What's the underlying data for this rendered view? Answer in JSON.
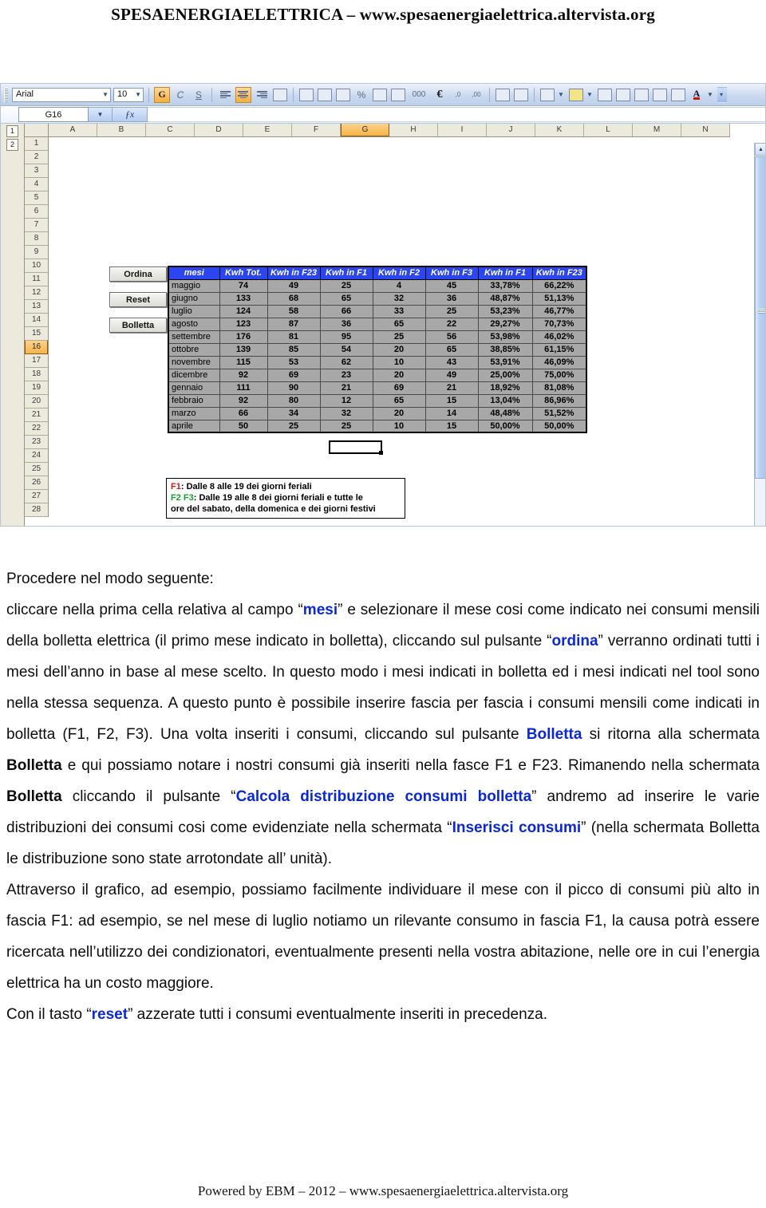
{
  "header": {
    "title": "SPESAENERGIAELETTRICA – www.spesaenergiaelettrica.altervista.org"
  },
  "footer": {
    "text": "Powered by EBM – 2012 – www.spesaenergiaelettrica.altervista.org"
  },
  "spreadsheet": {
    "toolbar": {
      "font_name": "Arial",
      "font_size": "10",
      "bold_label": "G",
      "italic_label": "C",
      "underline_label": "S",
      "percent_label": "%",
      "currency_label": "€",
      "thousands_label": "000",
      "inc_dec_label": ",0",
      "dec_dec_label": ",00",
      "font_color_label": "A"
    },
    "formula_bar": {
      "name_box": "G16",
      "fx_label": "fx",
      "formula_value": ""
    },
    "outline_buttons": [
      "1",
      "2"
    ],
    "column_headers": [
      "A",
      "B",
      "C",
      "D",
      "E",
      "F",
      "G",
      "H",
      "I",
      "J",
      "K",
      "L",
      "M",
      "N"
    ],
    "selected_column": "G",
    "row_headers": [
      "1",
      "2",
      "3",
      "4",
      "5",
      "6",
      "7",
      "8",
      "9",
      "10",
      "11",
      "12",
      "13",
      "14",
      "15",
      "16",
      "17",
      "18",
      "19",
      "20",
      "21",
      "22",
      "23",
      "24",
      "25",
      "26",
      "27",
      "28"
    ],
    "selected_row": "16"
  },
  "buttons": [
    {
      "label": "Ordina"
    },
    {
      "label": "Reset"
    },
    {
      "label": "Bolletta"
    }
  ],
  "table": {
    "headers": [
      "mesi",
      "Kwh Tot.",
      "Kwh in F23",
      "Kwh in F1",
      "Kwh in F2",
      "Kwh in F3",
      "Kwh in F1",
      "Kwh in F23"
    ],
    "rows": [
      [
        "maggio",
        "74",
        "49",
        "25",
        "4",
        "45",
        "33,78%",
        "66,22%"
      ],
      [
        "giugno",
        "133",
        "68",
        "65",
        "32",
        "36",
        "48,87%",
        "51,13%"
      ],
      [
        "luglio",
        "124",
        "58",
        "66",
        "33",
        "25",
        "53,23%",
        "46,77%"
      ],
      [
        "agosto",
        "123",
        "87",
        "36",
        "65",
        "22",
        "29,27%",
        "70,73%"
      ],
      [
        "settembre",
        "176",
        "81",
        "95",
        "25",
        "56",
        "53,98%",
        "46,02%"
      ],
      [
        "ottobre",
        "139",
        "85",
        "54",
        "20",
        "65",
        "38,85%",
        "61,15%"
      ],
      [
        "novembre",
        "115",
        "53",
        "62",
        "10",
        "43",
        "53,91%",
        "46,09%"
      ],
      [
        "dicembre",
        "92",
        "69",
        "23",
        "20",
        "49",
        "25,00%",
        "75,00%"
      ],
      [
        "gennaio",
        "111",
        "90",
        "21",
        "69",
        "21",
        "18,92%",
        "81,08%"
      ],
      [
        "febbraio",
        "92",
        "80",
        "12",
        "65",
        "15",
        "13,04%",
        "86,96%"
      ],
      [
        "marzo",
        "66",
        "34",
        "32",
        "20",
        "14",
        "48,48%",
        "51,52%"
      ],
      [
        "aprile",
        "50",
        "25",
        "25",
        "10",
        "15",
        "50,00%",
        "50,00%"
      ]
    ]
  },
  "legend": {
    "f1_tag": "F1",
    "f1_text": ": Dalle 8 alle 19 dei giorni feriali",
    "f2_tag": "F2",
    "f3_tag": "F3",
    "f23_text": ": Dalle 19 alle 8 dei giorni feriali e tutte le",
    "f23_text2": "ore del sabato, della domenica e dei giorni festivi"
  },
  "body": {
    "intro": "Procedere nel modo seguente:",
    "p1_a": "cliccare nella prima cella relativa al campo “",
    "p1_k1": "mesi",
    "p1_b": "” e selezionare il mese cosi come indicato nei consumi mensili della bolletta elettrica (il primo mese indicato in bolletta), cliccando sul pulsante “",
    "p1_k2": "ordina",
    "p1_c": "” verranno ordinati tutti i mesi dell’anno in base al mese scelto. In questo modo i mesi indicati in bolletta ed i mesi indicati nel tool sono nella stessa sequenza. A questo punto è possibile inserire fascia per fascia i consumi mensili come indicati in bolletta (F1, F2, F3). Una volta inseriti i consumi, cliccando sul pulsante ",
    "p1_k3": "Bolletta",
    "p1_d": " si ritorna alla schermata ",
    "p1_k4": "Bolletta",
    "p1_e": " e qui possiamo notare i nostri consumi già inseriti nella fasce F1 e F23. Rimanendo nella schermata ",
    "p1_k5": "Bolletta",
    "p1_f": " cliccando il pulsante “",
    "p1_k6": "Calcola distribuzione consumi bolletta",
    "p1_g": "” andremo ad inserire le varie distribuzioni dei consumi cosi come evidenziate nella schermata “",
    "p1_k7": "Inserisci consumi",
    "p1_h": "” (nella schermata Bolletta le distribuzione sono state arrotondate all’ unità).",
    "p2": "Attraverso il grafico, ad esempio, possiamo facilmente individuare il mese con il picco di consumi più alto in fascia F1: ad esempio, se nel mese di luglio notiamo un rilevante consumo in fascia F1, la causa potrà essere ricercata nell’utilizzo dei condizionatori, eventualmente presenti nella vostra abitazione, nelle ore in cui l’energia elettrica ha un costo maggiore.",
    "p3_a": "Con il tasto “",
    "p3_k": "reset",
    "p3_b": "” azzerate tutti i consumi eventualmente inseriti in precedenza."
  }
}
